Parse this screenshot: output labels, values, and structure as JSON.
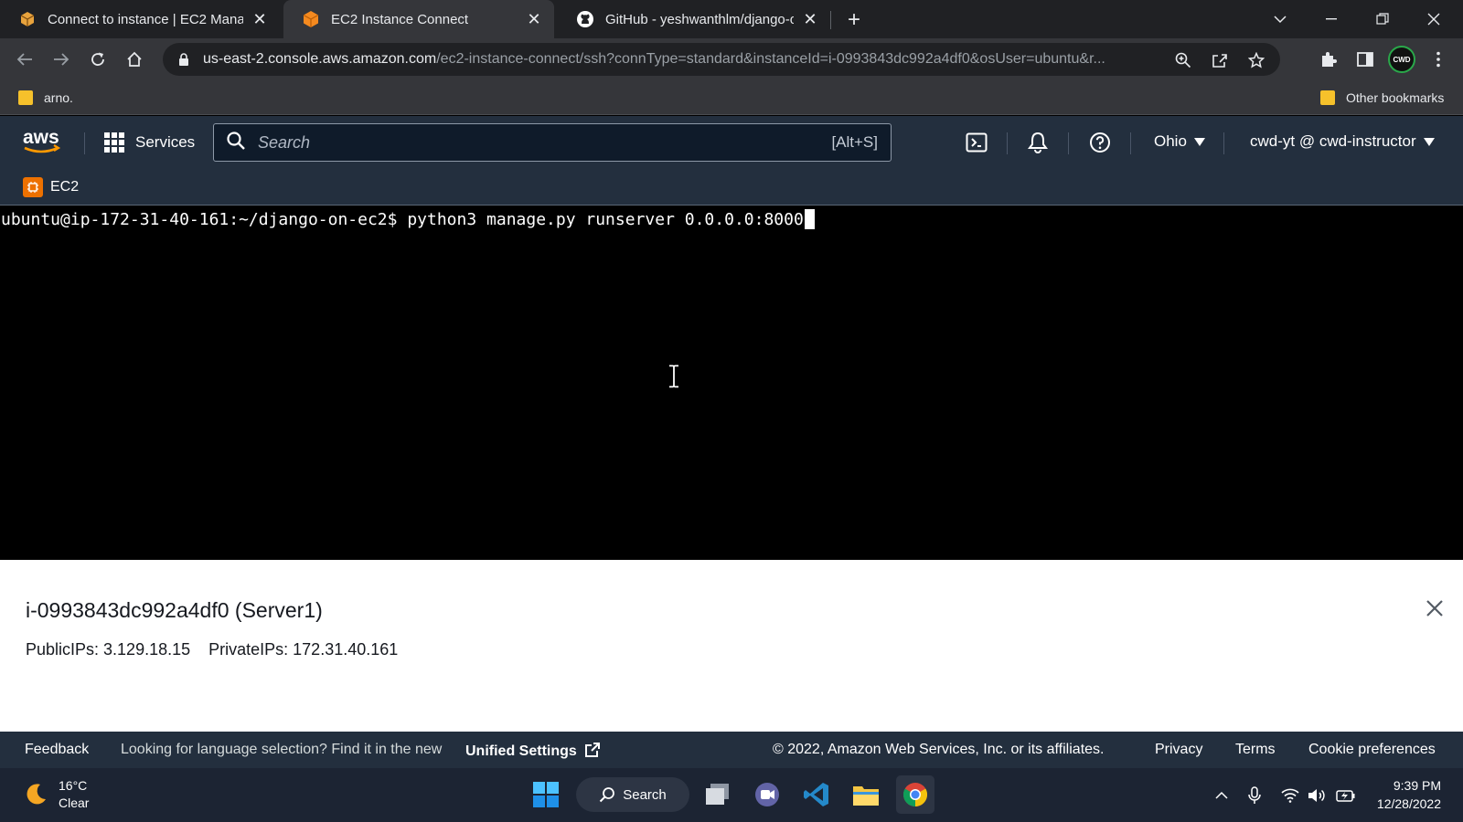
{
  "browser": {
    "tabs": [
      {
        "title": "Connect to instance | EC2 Manag",
        "active": false
      },
      {
        "title": "EC2 Instance Connect",
        "active": true
      },
      {
        "title": "GitHub - yeshwanthlm/django-o",
        "active": false
      }
    ],
    "address": {
      "host": "us-east-2.console.aws.amazon.com",
      "path": "/ec2-instance-connect/ssh?connType=standard&instanceId=i-0993843dc992a4df0&osUser=ubuntu&r..."
    },
    "profile_badge": "CWD",
    "bookmarks": [
      {
        "label": "arno."
      },
      {
        "label": "Other bookmarks"
      }
    ]
  },
  "aws_header": {
    "logo_text": "aws",
    "services_label": "Services",
    "search_placeholder": "Search",
    "search_shortcut": "[Alt+S]",
    "region": "Ohio",
    "account": "cwd-yt @ cwd-instructor",
    "service_name": "EC2"
  },
  "terminal": {
    "prompt": "ubuntu@ip-172-31-40-161:~/django-on-ec2$",
    "command": " python3 manage.py runserver 0.0.0.0:8000"
  },
  "instance": {
    "name": "i-0993843dc992a4df0 (Server1)",
    "public_ips": "PublicIPs: 3.129.18.15",
    "private_ips": "PrivateIPs: 172.31.40.161"
  },
  "footer": {
    "feedback": "Feedback",
    "language_note": "Looking for language selection? Find it in the new",
    "unified_settings": "Unified Settings",
    "copyright": "© 2022, Amazon Web Services, Inc. or its affiliates.",
    "privacy": "Privacy",
    "terms": "Terms",
    "cookie": "Cookie preferences"
  },
  "taskbar": {
    "temperature": "16°C",
    "condition": "Clear",
    "search_label": "Search",
    "time": "9:39 PM",
    "date": "12/28/2022"
  },
  "colors": {
    "aws_nav": "#232f3e",
    "aws_orange": "#ff9900",
    "ec2_orange": "#ed7100",
    "terminal_bg": "#000000",
    "chrome_dark": "#202124"
  }
}
